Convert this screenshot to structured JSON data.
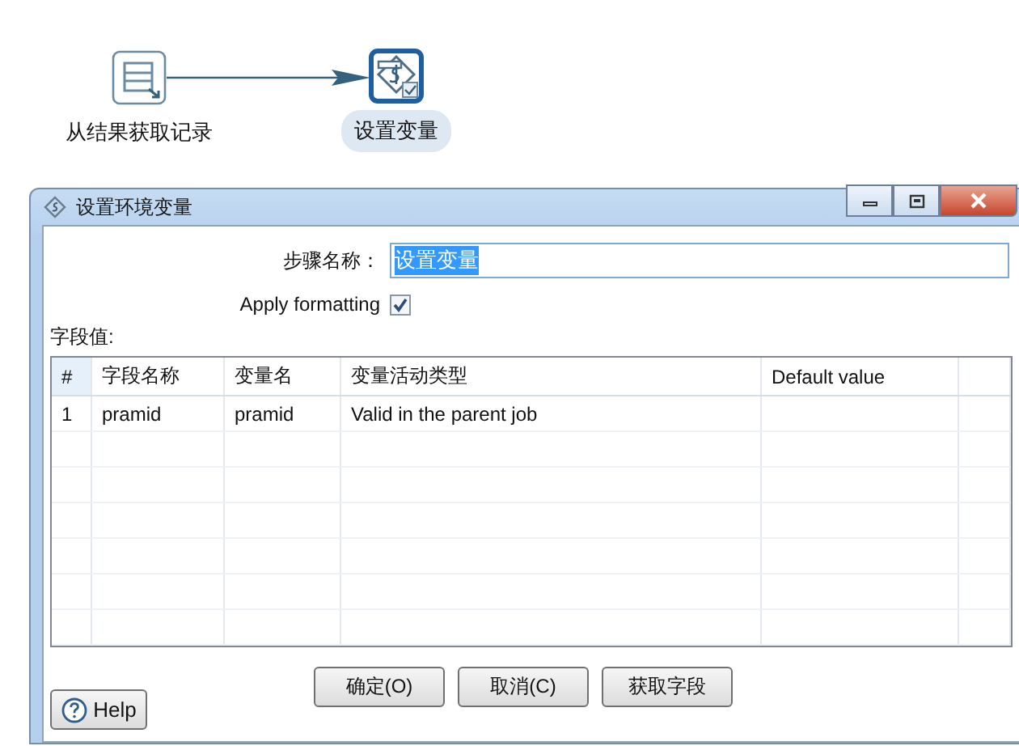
{
  "canvas": {
    "nodes": [
      {
        "label": "从结果获取记录",
        "kind": "rows",
        "selected": false
      },
      {
        "label": "设置变量",
        "kind": "variable",
        "selected": true
      }
    ]
  },
  "dialog": {
    "title": "设置环境变量",
    "step_name": {
      "label": "步骤名称：",
      "value": "设置变量",
      "value_selected": true
    },
    "apply_formatting": {
      "label": "Apply formatting",
      "checked": true
    },
    "fields_label": "字段值:",
    "table": {
      "columns": [
        "#",
        "字段名称",
        "变量名",
        "变量活动类型",
        "Default value"
      ],
      "rows": [
        [
          "1",
          "pramid",
          "pramid",
          "Valid in the parent job",
          ""
        ]
      ]
    },
    "buttons": [
      "确定(O)",
      "取消(C)",
      "获取字段"
    ],
    "help": "Help"
  }
}
